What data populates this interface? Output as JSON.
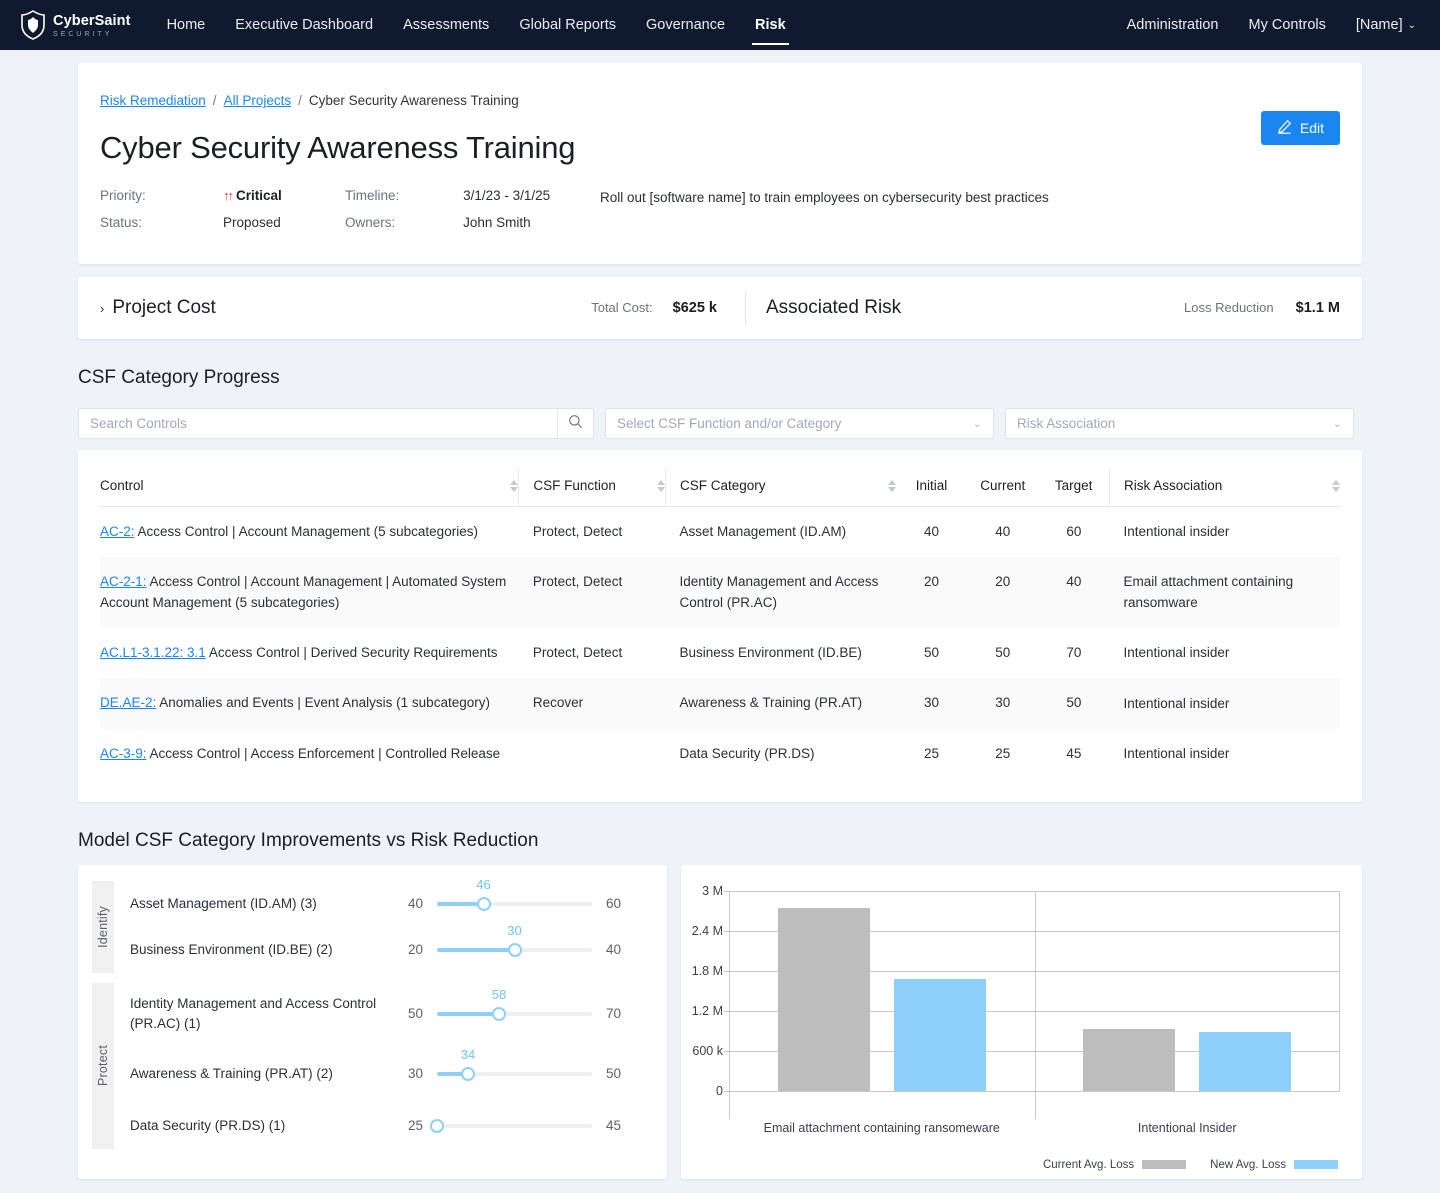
{
  "nav": {
    "brand_name": "CyberSaint",
    "brand_sub": "SECURITY",
    "links": [
      {
        "label": "Home",
        "active": false
      },
      {
        "label": "Executive Dashboard",
        "active": false
      },
      {
        "label": "Assessments",
        "active": false
      },
      {
        "label": "Global Reports",
        "active": false
      },
      {
        "label": "Governance",
        "active": false
      },
      {
        "label": "Risk",
        "active": true
      }
    ],
    "right": [
      {
        "label": "Administration"
      },
      {
        "label": "My Controls"
      },
      {
        "label": "[Name]",
        "caret": "⌄"
      }
    ]
  },
  "breadcrumb": {
    "item1": "Risk Remediation",
    "sep1": "/",
    "item2": "All Projects",
    "sep2": "/",
    "current": "Cyber Security Awareness Training"
  },
  "header": {
    "title": "Cyber Security Awareness Training",
    "priority_label": "Priority:",
    "priority_value": "Critical",
    "priority_icon": "↑↑",
    "status_label": "Status:",
    "status_value": "Proposed",
    "timeline_label": "Timeline:",
    "timeline_value": "3/1/23  -  3/1/25",
    "owners_label": "Owners:",
    "owners_value": "John Smith",
    "description": "Roll out [software name] to train employees on cybersecurity best practices",
    "edit_label": "Edit"
  },
  "cost": {
    "section_title": "Project Cost",
    "chevron": "›",
    "total_label": "Total Cost:",
    "total_value": "$625 k",
    "risk_title": "Associated Risk",
    "loss_label": "Loss Reduction",
    "loss_value": "$1.1 M"
  },
  "progress": {
    "title": "CSF Category Progress",
    "search_placeholder": "Search Controls",
    "search_value": "",
    "filter_function": "Select CSF Function and/or Category",
    "filter_risk": "Risk Association",
    "columns": [
      "Control",
      "CSF Function",
      "CSF Category",
      "Initial",
      "Current",
      "Target",
      "Risk Association"
    ],
    "rows": [
      {
        "control_id": "AC-2:",
        "control_text": " Access Control | Account Management (5 subcategories)",
        "function": "Protect, Detect",
        "category": "Asset Management (ID.AM)",
        "initial": "40",
        "current": "40",
        "target": "60",
        "risk": "Intentional insider"
      },
      {
        "control_id": "AC-2-1:",
        "control_text": " Access Control | Account Management | Automated System Account Management (5 subcategories)",
        "function": "Protect, Detect",
        "category": "Identity Management and  Access Control (PR.AC)",
        "initial": "20",
        "current": "20",
        "target": "40",
        "risk": "Email attachment containing ransomware"
      },
      {
        "control_id": "AC.L1-3.1.22: 3.1",
        "control_text": " Access Control | Derived Security Requirements",
        "function": "Protect, Detect",
        "category": "Business Environment (ID.BE)",
        "initial": "50",
        "current": "50",
        "target": "70",
        "risk": "Intentional insider"
      },
      {
        "control_id": "DE.AE-2:",
        "control_text": " Anomalies and Events | Event Analysis (1 subcategory)",
        "function": "Recover",
        "category": "Awareness & Training (PR.AT)",
        "initial": "30",
        "current": "30",
        "target": "50",
        "risk": "Intentional insider"
      },
      {
        "control_id": "AC-3-9:",
        "control_text": " Access Control | Access Enforcement | Controlled Release",
        "function": "",
        "category": "Data Security (PR.DS)",
        "initial": "25",
        "current": "25",
        "target": "45",
        "risk": "Intentional insider"
      }
    ]
  },
  "model": {
    "title": "Model CSF Category Improvements vs Risk Reduction",
    "groups": [
      {
        "label": "Identify",
        "rows": [
          {
            "name": "Asset Management (ID.AM) (3)",
            "min": 40,
            "max": 60,
            "value": 46
          },
          {
            "name": "Business Environment (ID.BE) (2)",
            "min": 20,
            "max": 40,
            "value": 30
          }
        ]
      },
      {
        "label": "Protect",
        "rows": [
          {
            "name": "Identity Management and Access Control (PR.AC) (1)",
            "min": 50,
            "max": 70,
            "value": 58
          },
          {
            "name": "Awareness & Training (PR.AT) (2)",
            "min": 30,
            "max": 50,
            "value": 34
          },
          {
            "name": "Data Security (PR.DS) (1)",
            "min": 25,
            "max": 45,
            "value": 25
          }
        ]
      }
    ]
  },
  "chart_data": {
    "type": "bar",
    "title": "",
    "xlabel": "",
    "ylabel": "",
    "categories": [
      "Email attachment containing ransomeware",
      "Intentional Insider"
    ],
    "series": [
      {
        "name": "Current Avg. Loss",
        "color": "#bdbdbd",
        "values": [
          2740000,
          930000
        ]
      },
      {
        "name": "New Avg. Loss",
        "color": "#8ed0f9",
        "values": [
          1680000,
          875000
        ]
      }
    ],
    "ylim": [
      0,
      3000000
    ],
    "yticks": [
      0,
      600000,
      1200000,
      1800000,
      2400000,
      3000000
    ],
    "ytick_labels": [
      "0",
      "600 k",
      "1.2 M",
      "1.8 M",
      "2.4 M",
      "3 M"
    ],
    "grid": true,
    "legend_position": "bottom-right"
  },
  "colors": {
    "accent": "#1a86f0",
    "nav_bg": "#101a2e",
    "slider": "#8ed0f9",
    "grey_bar": "#bdbdbd",
    "critical": "#e23b3b"
  }
}
